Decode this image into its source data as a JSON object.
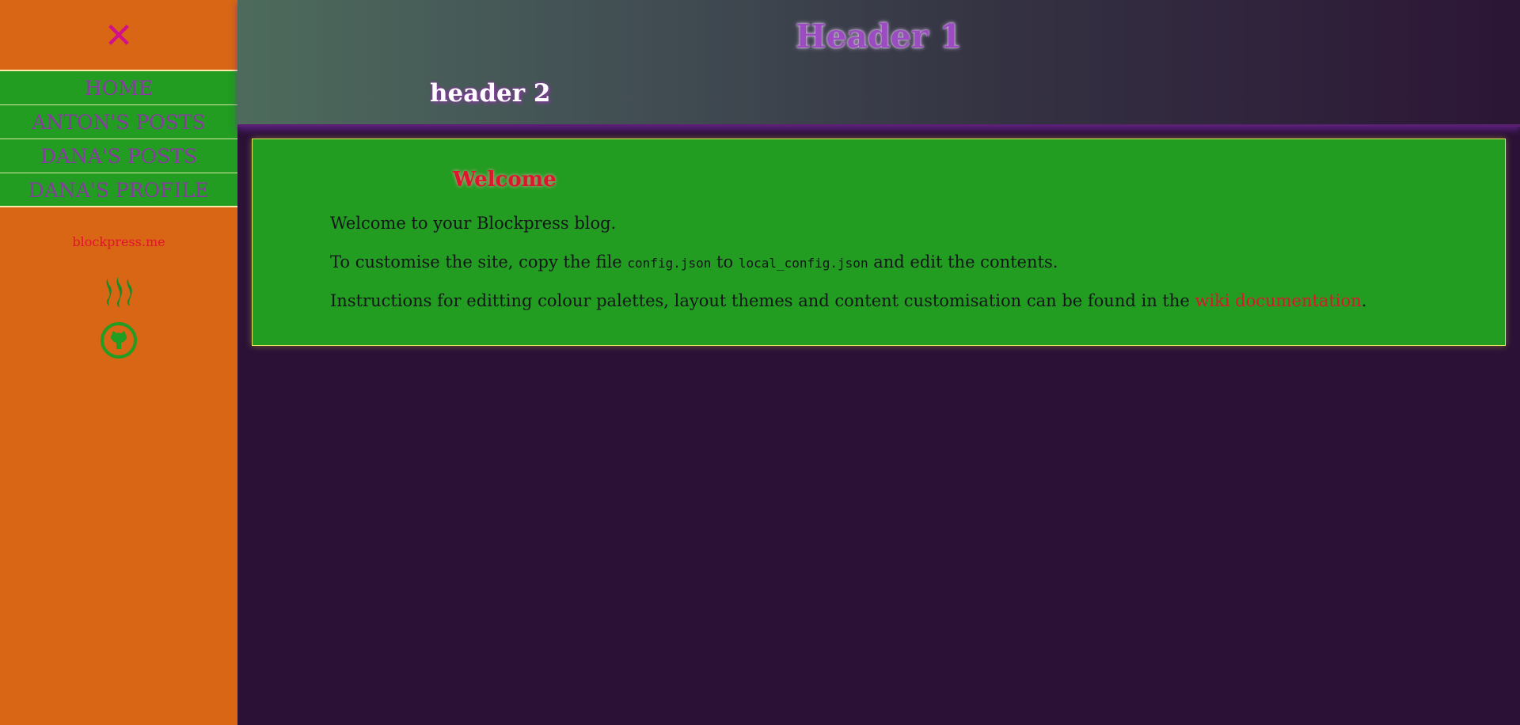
{
  "sidebar": {
    "close_glyph": "✕",
    "nav_items": [
      {
        "label": "HOME"
      },
      {
        "label": "ANTON'S POSTS"
      },
      {
        "label": "DANA'S POSTS"
      },
      {
        "label": "DANA'S PROFILE"
      }
    ],
    "site_link": "blockpress.me",
    "icons": [
      "steem-icon",
      "github-icon"
    ]
  },
  "header": {
    "title": "Header 1",
    "subtitle": "header 2"
  },
  "content": {
    "title": "Welcome",
    "line1": "Welcome to your Blockpress blog.",
    "line2": {
      "before": "To customise the site, copy the file ",
      "code1": "config.json",
      "middle": " to ",
      "code2": "local_config.json",
      "after": " and edit the contents."
    },
    "line3": {
      "before": "Instructions for editting colour palettes, layout themes and content customisation can be found in the ",
      "link": "wiki documentation",
      "after": "."
    }
  },
  "colors": {
    "sidebar_bg": "#d86614",
    "nav_bg": "#229c21",
    "nav_text": "#8a3aa3",
    "page_bg": "#2b1136",
    "accent_red": "#e0142c",
    "close_pink": "#d2108c"
  }
}
